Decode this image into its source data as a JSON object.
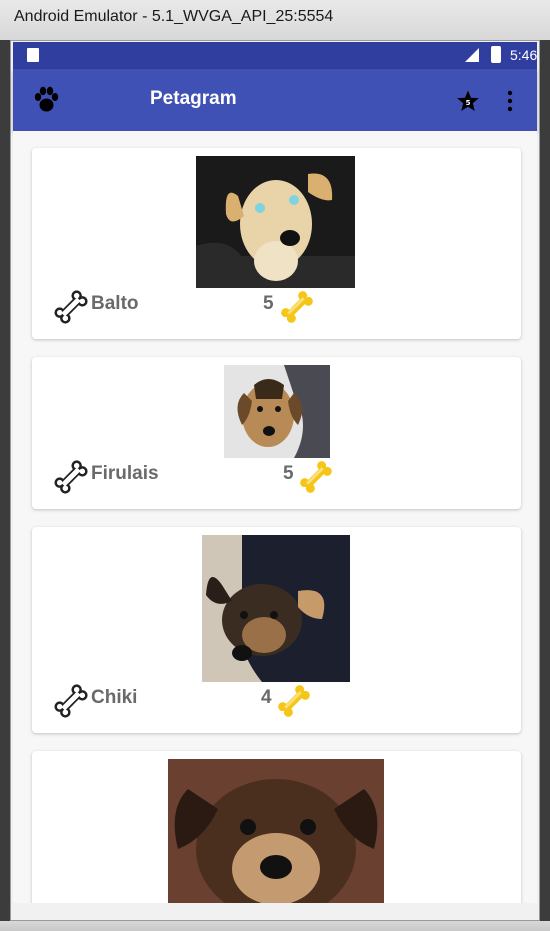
{
  "window": {
    "title": "Android Emulator - 5.1_WVGA_API_25:5554"
  },
  "status_bar": {
    "time": "5:46"
  },
  "toolbar": {
    "title": "Petagram",
    "icons": [
      "paw-icon",
      "star-icon",
      "more-vert-icon"
    ]
  },
  "pets": [
    {
      "name": "Balto",
      "likes": "5"
    },
    {
      "name": "Firulais",
      "likes": "5"
    },
    {
      "name": "Chiki",
      "likes": "4"
    },
    {
      "name": "",
      "likes": ""
    }
  ],
  "colors": {
    "primary": "#3f51b5",
    "primary_dark": "#303f9f",
    "bone_yellow": "#f5c518"
  }
}
